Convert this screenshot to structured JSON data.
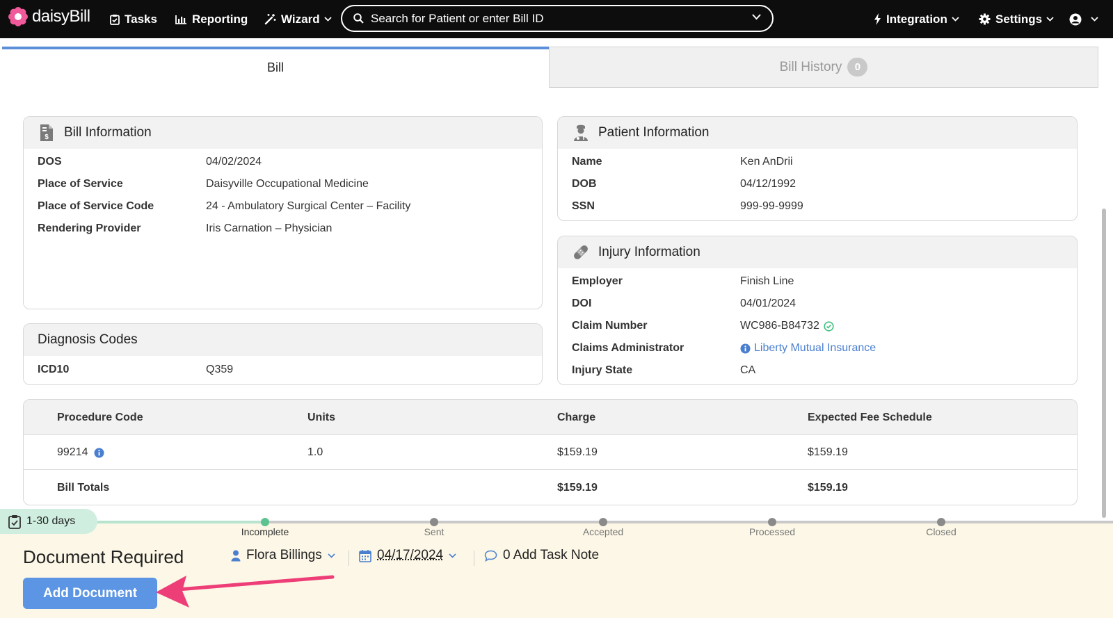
{
  "nav": {
    "logo_text": "daisyBill",
    "tasks": "Tasks",
    "reporting": "Reporting",
    "wizard": "Wizard",
    "search_placeholder": "Search for Patient or enter Bill ID",
    "integration": "Integration",
    "settings": "Settings"
  },
  "tabs": {
    "bill": "Bill",
    "history": "Bill History",
    "history_count": "0"
  },
  "bill_info": {
    "title": "Bill Information",
    "rows": [
      {
        "label": "DOS",
        "value": "04/02/2024"
      },
      {
        "label": "Place of Service",
        "value": "Daisyville Occupational Medicine"
      },
      {
        "label": "Place of Service Code",
        "value": "24 - Ambulatory Surgical Center – Facility"
      },
      {
        "label": "Rendering Provider",
        "value": "Iris Carnation – Physician"
      }
    ]
  },
  "patient_info": {
    "title": "Patient Information",
    "rows": [
      {
        "label": "Name",
        "value": "Ken AnDrii"
      },
      {
        "label": "DOB",
        "value": "04/12/1992"
      },
      {
        "label": "SSN",
        "value": "999-99-9999"
      }
    ]
  },
  "injury_info": {
    "title": "Injury Information",
    "rows": [
      {
        "label": "Employer",
        "value": "Finish Line"
      },
      {
        "label": "DOI",
        "value": "04/01/2024"
      },
      {
        "label": "Claim Number",
        "value": "WC986-B84732"
      },
      {
        "label": "Claims Administrator",
        "value": "Liberty Mutual Insurance"
      },
      {
        "label": "Injury State",
        "value": "CA"
      }
    ]
  },
  "diagnosis": {
    "title": "Diagnosis Codes",
    "label": "ICD10",
    "value": "Q359"
  },
  "procedures": {
    "headers": [
      "Procedure Code",
      "Units",
      "Charge",
      "Expected Fee Schedule"
    ],
    "rows": [
      {
        "code": "99214",
        "units": "1.0",
        "charge": "$159.19",
        "expected": "$159.19"
      }
    ],
    "totals": {
      "label": "Bill Totals",
      "charge": "$159.19",
      "expected": "$159.19"
    }
  },
  "status": {
    "days": "1-30 days",
    "steps": [
      "Incomplete",
      "Sent",
      "Accepted",
      "Processed",
      "Closed"
    ],
    "title": "Document Required",
    "assignee": "Flora Billings",
    "date": "04/17/2024",
    "task_note": "0 Add Task Note",
    "add_document": "Add Document"
  },
  "colors": {
    "nav_bg": "#0d0d0d",
    "accent": "#5b95e3",
    "link": "#4a7fd0",
    "status_bg": "#fcf7e6",
    "arrow": "#ee3e78"
  }
}
